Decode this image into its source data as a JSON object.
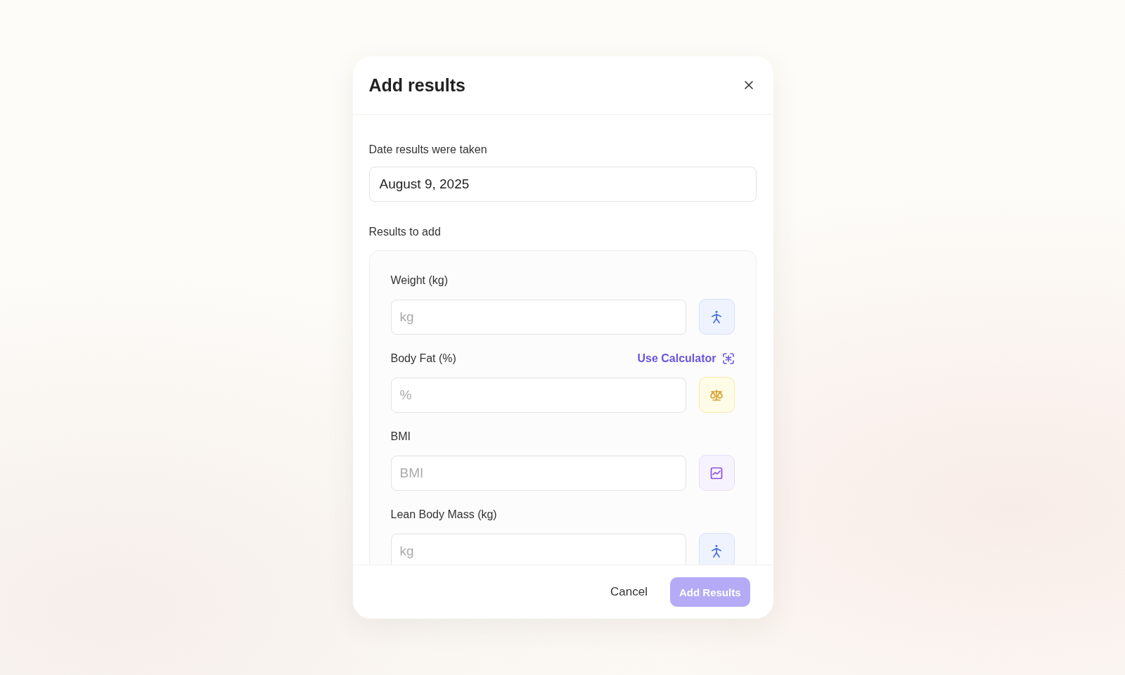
{
  "dialog": {
    "title": "Add results"
  },
  "date": {
    "label": "Date results were taken",
    "value": "August 9, 2025"
  },
  "results": {
    "label": "Results to add",
    "items": [
      {
        "label": "Weight (kg)",
        "placeholder": "kg",
        "kind": "walking"
      },
      {
        "label": "Body Fat (%)",
        "placeholder": "%",
        "kind": "scale",
        "link": "Use Calculator"
      },
      {
        "label": "BMI",
        "placeholder": "BMI",
        "kind": "chart"
      },
      {
        "label": "Lean Body Mass (kg)",
        "placeholder": "kg",
        "kind": "walking"
      }
    ]
  },
  "buttons": {
    "cancel": "Cancel",
    "submit": {
      "label": "Add Results",
      "disabled": true
    }
  }
}
